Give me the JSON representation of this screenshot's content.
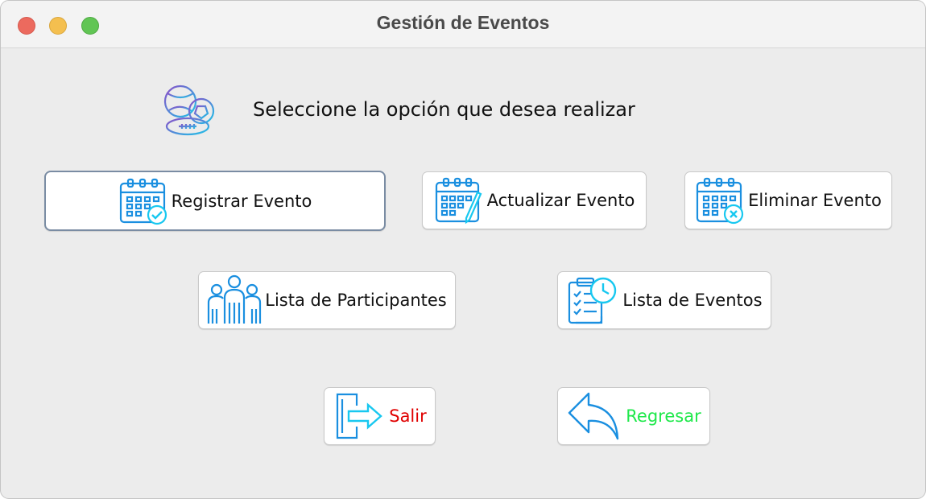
{
  "window": {
    "title": "Gestión de Eventos",
    "controls": [
      "close",
      "minimize",
      "maximize"
    ]
  },
  "header": {
    "icon": "sports-balls-icon",
    "prompt": "Seleccione la opción que desea realizar"
  },
  "buttons": {
    "registrar": {
      "label": "Registrar Evento",
      "icon": "calendar-check-icon"
    },
    "actualizar": {
      "label": "Actualizar Evento",
      "icon": "calendar-edit-icon"
    },
    "eliminar": {
      "label": "Eliminar Evento",
      "icon": "calendar-delete-icon"
    },
    "participantes": {
      "label": "Lista de Participantes",
      "icon": "people-group-icon"
    },
    "eventos": {
      "label": "Lista de Eventos",
      "icon": "checklist-clock-icon"
    },
    "salir": {
      "label": "Salir",
      "icon": "exit-door-icon",
      "color": "#e00000"
    },
    "regresar": {
      "label": "Regresar",
      "icon": "back-arrow-icon",
      "color": "#1ee84a"
    }
  },
  "colors": {
    "icon_blue": "#1a8fe0",
    "icon_cyan": "#18c8f0",
    "window_bg": "#ececec",
    "focus_border": "#7a8ca3"
  }
}
